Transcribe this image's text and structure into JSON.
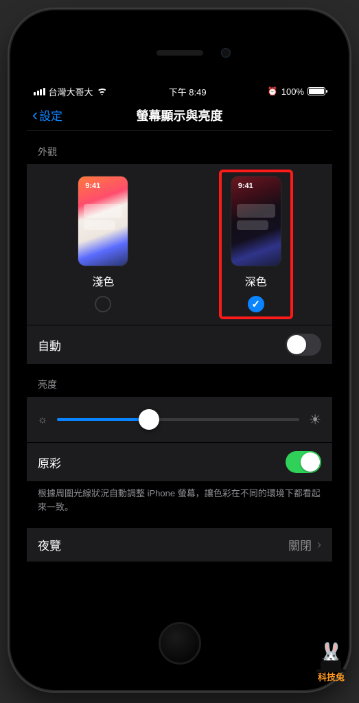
{
  "status": {
    "carrier": "台灣大哥大",
    "time": "下午 8:49",
    "battery_pct": "100%"
  },
  "nav": {
    "back_label": "設定",
    "title": "螢幕顯示與亮度"
  },
  "appearance": {
    "header": "外觀",
    "preview_time": "9:41",
    "light_label": "淺色",
    "dark_label": "深色",
    "selected": "dark"
  },
  "rows": {
    "auto_label": "自動",
    "auto_on": false,
    "brightness_header": "亮度",
    "brightness_value": 0.38,
    "true_tone_label": "原彩",
    "true_tone_on": true,
    "true_tone_footer": "根據周圍光線狀況自動調整 iPhone 螢幕，讓色彩在不同的環境下都看起來一致。",
    "night_shift_label": "夜覽",
    "night_shift_value": "關閉"
  },
  "watermark": {
    "text": "科技兔"
  },
  "colors": {
    "accent": "#0a84ff",
    "green": "#30d158",
    "highlight": "#ff1a1a"
  }
}
